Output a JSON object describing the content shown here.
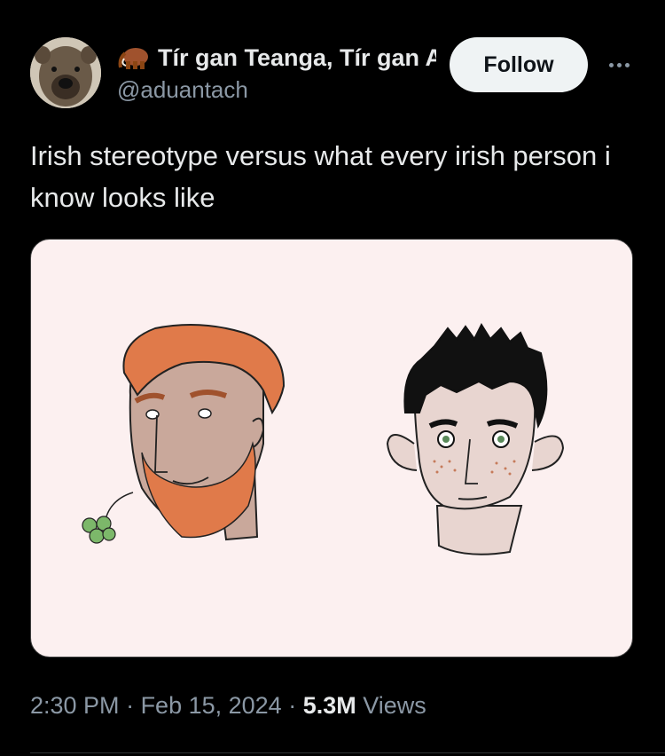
{
  "author": {
    "display_name": "Tír gan Teanga, Tír gan Anam",
    "handle": "@aduantach",
    "avatar_icon": "bear-face-avatar",
    "badge_icon": "mammoth-emoji-icon"
  },
  "actions": {
    "follow_label": "Follow",
    "more_icon": "more-horizontal-icon"
  },
  "tweet": {
    "text": "Irish stereotype versus what every irish person i know looks like",
    "media": {
      "left_figure": "ginger-bearded-man-with-shamrock",
      "right_figure": "black-haired-freckled-man"
    }
  },
  "meta": {
    "time": "2:30 PM",
    "sep1": " · ",
    "date": "Feb 15, 2024",
    "sep2": " · ",
    "views_count": "5.3M",
    "views_label": " Views"
  },
  "colors": {
    "background": "#000000",
    "text": "#e7e9ea",
    "secondary_text": "#8b98a5",
    "follow_bg": "#eff3f4",
    "media_bg": "#fcf0f0",
    "ginger": "#e07a4a",
    "shamrock": "#7cb86a"
  }
}
